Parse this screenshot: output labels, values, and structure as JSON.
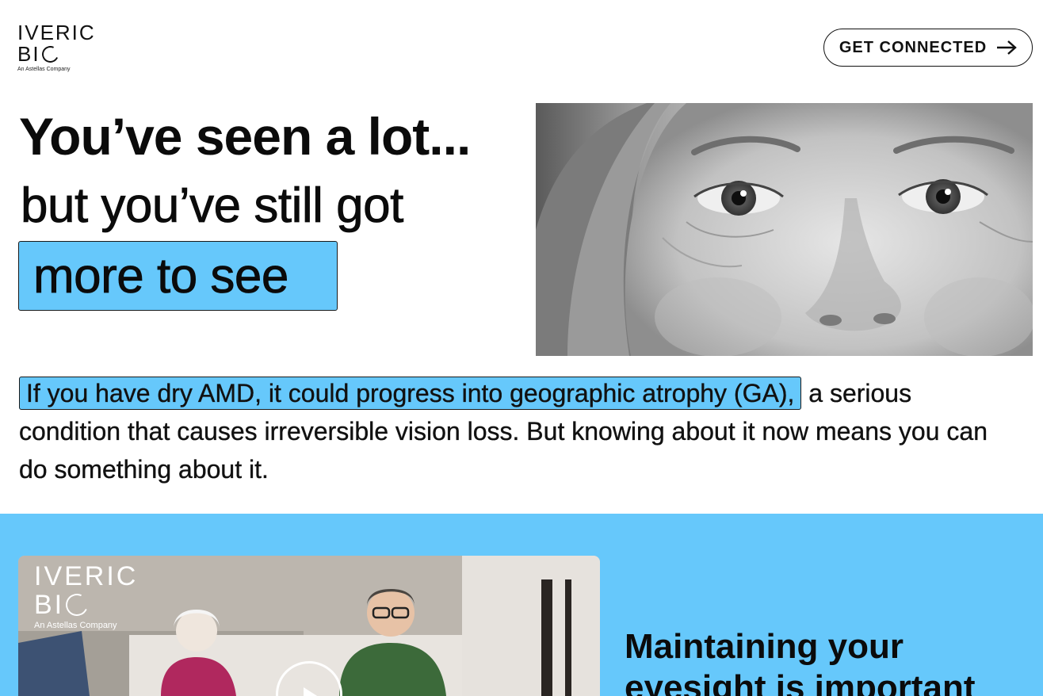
{
  "brand": {
    "logo_line1": "IVERIC",
    "logo_line2_prefix": "BI",
    "logo_tagline": "An Astellas Company"
  },
  "header": {
    "cta_label": "GET CONNECTED"
  },
  "hero": {
    "headline_line1": "You’ve seen a lot...",
    "headline_line2": "but you’ve still got",
    "headline_highlight": "more to see"
  },
  "intro": {
    "highlight": "If you have dry AMD, it could progress into geographic atrophy (GA),",
    "rest": " a serious condition that causes irreversible vision loss. But knowing about it now means you can do something about it."
  },
  "video": {
    "logo_line1": "IVERIC",
    "logo_line2_prefix": "BI",
    "logo_tagline": "An Astellas Company"
  },
  "section": {
    "title": "Maintaining your eyesight is important"
  },
  "colors": {
    "accent_blue": "#66c8fb",
    "text": "#0b0b0b",
    "background": "#ffffff"
  },
  "icons": [
    "arrow-right-icon",
    "play-icon"
  ]
}
